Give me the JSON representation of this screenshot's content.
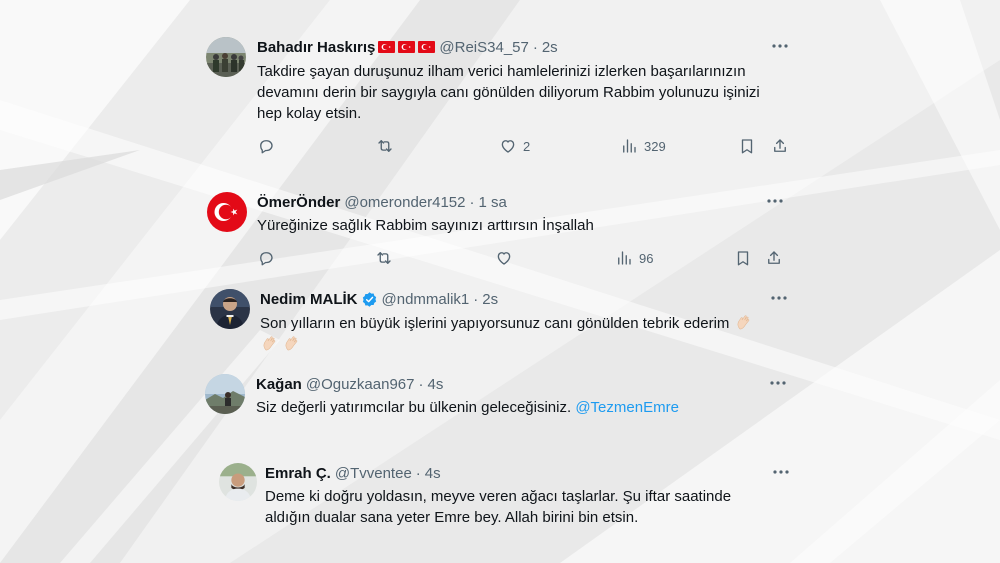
{
  "tweets": [
    {
      "name": "Bahadır Haskırış",
      "handle": "@ReiS34_57",
      "time": "2s",
      "text": "Takdire şayan duruşunuz ilham verici hamlelerinizi izlerken başarılarınızın devamını derin bir saygıyla canı gönülden diliyorum Rabbim yolunuzu işinizi hep kolay etsin.",
      "likes": "2",
      "views": "329",
      "name_decoration": "turkey-flag-x3"
    },
    {
      "name": "ÖmerÖnder",
      "handle": "@omeronder4152",
      "time": "1 sa",
      "text": "Yüreğinize sağlık Rabbim sayınızı arttırsın İnşallah",
      "views": "96"
    },
    {
      "name": "Nedim MALİK",
      "handle": "@ndmmalik1",
      "time": "2s",
      "text": "Son yılların en büyük işlerini yapıyorsunuz canı gönülden tebrik ederim",
      "verified": true,
      "emoji": "clapping-hands-x3"
    },
    {
      "name": "Kağan",
      "handle": "@Oguzkaan967",
      "time": "4s",
      "text": "Siz değerli yatırımcılar bu ülkenin geleceğisiniz.",
      "mention": "@TezmenEmre"
    },
    {
      "name": "Emrah Ç.",
      "handle": "@Tvventee",
      "time": "4s",
      "text": "Deme ki doğru yoldasın, meyve veren ağacı taşlarlar. Şu iftar saatinde aldığın dualar sana yeter Emre bey. Allah birini bin etsin."
    }
  ],
  "separator": "·",
  "colors": {
    "text": "#0f1419",
    "secondary": "#536471",
    "link": "#1d9bf0",
    "flag_red": "#e30a17",
    "verified_blue": "#1d9bf0",
    "background": "#eeeeee"
  },
  "icons": {
    "more": "more-horizontal-icon",
    "reply": "reply-icon",
    "retweet": "retweet-icon",
    "like": "heart-icon",
    "views": "views-bar-chart-icon",
    "bookmark": "bookmark-icon",
    "share": "share-icon"
  }
}
